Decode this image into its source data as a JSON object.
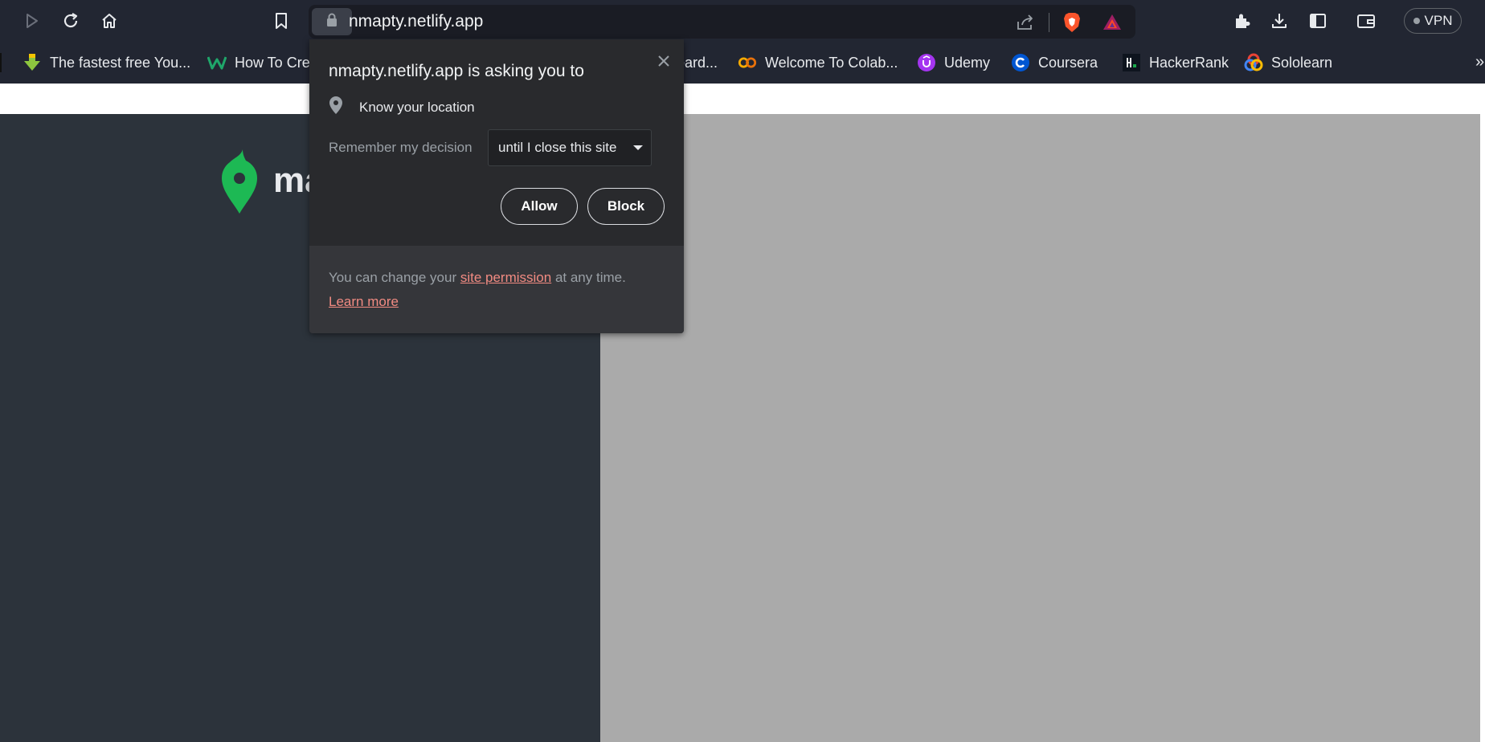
{
  "browser": {
    "url": "nmapty.netlify.app",
    "vpn_label": "VPN"
  },
  "bookmarks": [
    {
      "label": "The fastest free You...",
      "icon": "download-arrow-icon"
    },
    {
      "label": "How To Cre",
      "icon": "w-logo-icon"
    },
    {
      "label": "board...",
      "icon": "bookmark-icon"
    },
    {
      "label": "Welcome To Colab...",
      "icon": "colab-icon"
    },
    {
      "label": "Udemy",
      "icon": "udemy-icon"
    },
    {
      "label": "Coursera",
      "icon": "coursera-icon"
    },
    {
      "label": "HackerRank",
      "icon": "hackerrank-icon"
    },
    {
      "label": "Sololearn",
      "icon": "sololearn-icon"
    }
  ],
  "bookmarks_more": "»",
  "page": {
    "logo_text": "ma"
  },
  "permission_popup": {
    "title": "nmapty.netlify.app is asking you to",
    "permission": "Know your location",
    "remember_label": "Remember my decision",
    "remember_value": "until I close this site",
    "allow_label": "Allow",
    "block_label": "Block",
    "footer_prefix": "You can change your ",
    "footer_link": "site permission",
    "footer_suffix": " at any time.",
    "learn_more": "Learn more"
  },
  "colors": {
    "toolbar_bg": "#222632",
    "page_left_bg": "#2c333b",
    "page_right_bg": "#aaaaaa",
    "popup_bg": "#292a2d",
    "link": "#f28b82",
    "logo_green": "#1db954"
  }
}
